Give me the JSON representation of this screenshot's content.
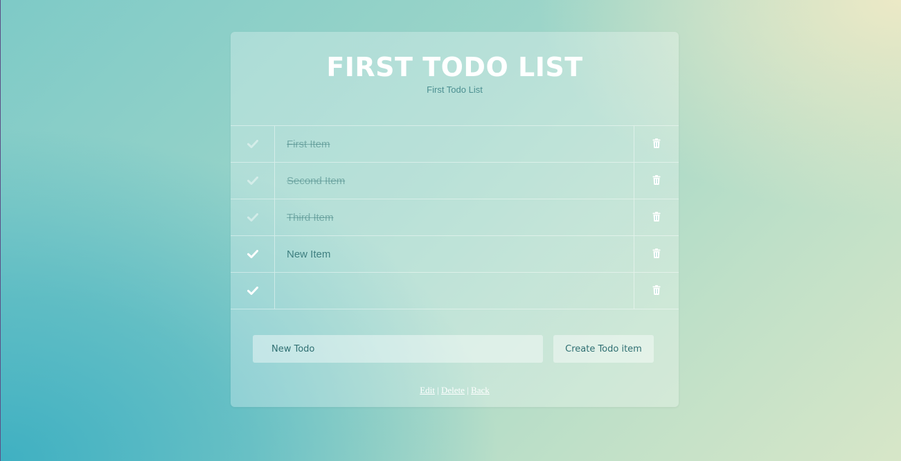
{
  "page": {
    "title": "FIRST TODO LIST",
    "subtitle": "First Todo List"
  },
  "todos": [
    {
      "text": "First Item",
      "completed": true
    },
    {
      "text": "Second Item",
      "completed": true
    },
    {
      "text": "Third Item",
      "completed": true
    },
    {
      "text": "New Item",
      "completed": false
    },
    {
      "text": "",
      "completed": false
    }
  ],
  "form": {
    "input_value": "",
    "input_placeholder": "New Todo",
    "submit_label": "Create Todo item"
  },
  "footer": {
    "edit_label": "Edit",
    "delete_label": "Delete",
    "back_label": "Back",
    "separator": "|"
  },
  "icons": {
    "check": "check-icon",
    "delete": "trash-icon"
  },
  "colors": {
    "accent_text": "#3f7f80",
    "icon_active": "#ffffff",
    "icon_done": "rgba(255,255,255,0.45)"
  }
}
